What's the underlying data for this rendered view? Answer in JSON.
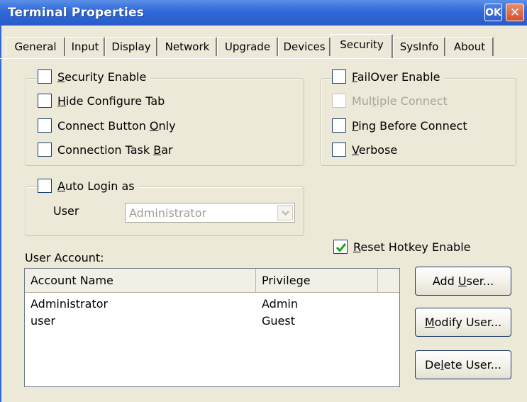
{
  "window": {
    "title": "Terminal Properties",
    "ok_label": "OK",
    "close_label": "✕"
  },
  "tabs": [
    "General",
    "Input",
    "Display",
    "Network",
    "Upgrade",
    "Devices",
    "Security",
    "SysInfo",
    "About"
  ],
  "active_tab": "Security",
  "security": {
    "security_enable": {
      "label": "Security Enable",
      "checked": false
    },
    "hide_configure_tab": {
      "label": "Hide Configure Tab",
      "checked": false
    },
    "connect_button_only": {
      "label": "Connect Button Only",
      "checked": false
    },
    "connection_task_bar": {
      "label": "Connection Task Bar",
      "checked": false
    }
  },
  "failover": {
    "failover_enable": {
      "label": "FailOver Enable",
      "checked": false
    },
    "multiple_connect": {
      "label": "Multiple Connect",
      "checked": false,
      "disabled": true
    },
    "ping_before_connect": {
      "label": "Ping Before Connect",
      "checked": false
    },
    "verbose": {
      "label": "Verbose",
      "checked": false
    }
  },
  "auto_login": {
    "label": "Auto Login as",
    "checked": false,
    "user_label": "User",
    "user_value": "Administrator"
  },
  "reset_hotkey": {
    "label": "Reset Hotkey Enable",
    "checked": true
  },
  "user_account": {
    "label": "User Account:",
    "columns": [
      "Account Name",
      "Privilege"
    ],
    "rows": [
      {
        "name": "Administrator",
        "privilege": "Admin"
      },
      {
        "name": "user",
        "privilege": "Guest"
      }
    ]
  },
  "buttons": {
    "add_user": "Add User...",
    "modify_user": "Modify User...",
    "delete_user": "Delete User..."
  },
  "colors": {
    "titlebar": "#2F68D8",
    "dialog_bg": "#ECE9D8",
    "check_accent": "#21A121"
  }
}
